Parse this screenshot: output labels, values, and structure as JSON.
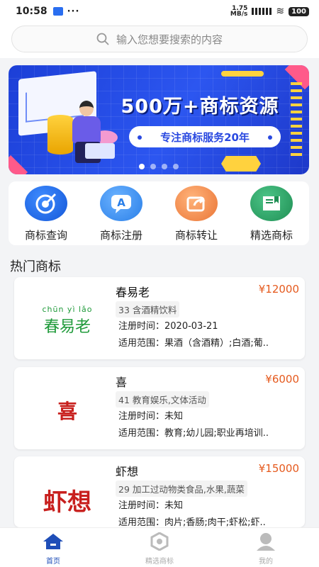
{
  "status": {
    "time": "10:58",
    "dots": "···",
    "net_top": "1.75",
    "net_unit": "MB/s",
    "battery": "100"
  },
  "search": {
    "placeholder": "输入您想要搜索的内容"
  },
  "banner": {
    "title": "500万+商标资源",
    "subtitle": "专注商标服务20年",
    "dots_count": 4,
    "active_dot": 0
  },
  "services": [
    {
      "label": "商标查询",
      "icon": "target-icon",
      "color": "#1f6fe0"
    },
    {
      "label": "商标注册",
      "icon": "chat-a-icon",
      "color": "#3a8ff0"
    },
    {
      "label": "商标转让",
      "icon": "share-icon",
      "color": "#f08a4b"
    },
    {
      "label": "精选商标",
      "icon": "book-icon",
      "color": "#2fa86a"
    }
  ],
  "hot_title": "热门商标",
  "trademarks": [
    {
      "name": "春易老",
      "price": "¥12000",
      "category": "33 含酒精饮料",
      "reg_time": "注册时间：2020-03-21",
      "scope": "适用范围：果酒（含酒精）;白酒;葡..",
      "logo_pinyin": "chūn yì lǎo",
      "logo_text": "春易老"
    },
    {
      "name": "喜",
      "price": "¥6000",
      "category": "41 教育娱乐,文体活动",
      "reg_time": "注册时间：未知",
      "scope": "适用范围：教育;幼儿园;职业再培训..",
      "logo_text": "喜"
    },
    {
      "name": "虾想",
      "price": "¥15000",
      "category": "29 加工过动物类食品,水果,蔬菜",
      "reg_time": "注册时间：未知",
      "scope": "适用范围：肉片;香肠;肉干;虾松;虾..",
      "logo_text": "虾想"
    }
  ],
  "tabs": [
    {
      "label": "首页",
      "icon": "home-icon",
      "active": true
    },
    {
      "label": "精选商标",
      "icon": "brand-icon",
      "active": false
    },
    {
      "label": "我的",
      "icon": "user-icon",
      "active": false
    }
  ]
}
